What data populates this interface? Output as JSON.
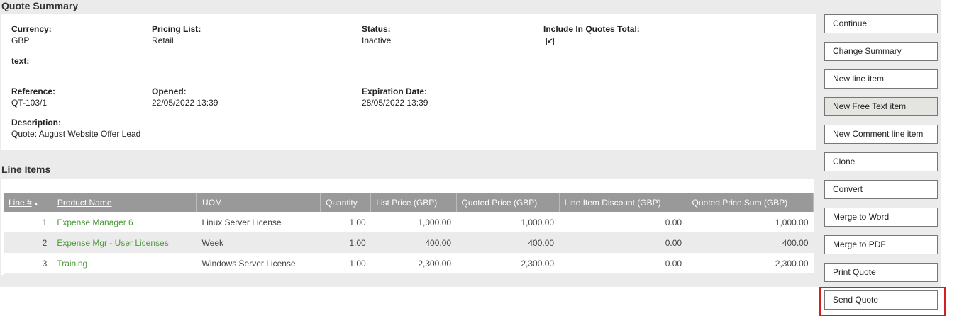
{
  "summary": {
    "title": "Quote Summary",
    "currency_label": "Currency:",
    "currency": "GBP",
    "pricing_label": "Pricing List:",
    "pricing": "Retail",
    "status_label": "Status:",
    "status": "Inactive",
    "include_label": "Include In Quotes Total:",
    "include_checked": true,
    "text_label": "text:",
    "reference_label": "Reference:",
    "reference": "QT-103/1",
    "opened_label": "Opened:",
    "opened": "22/05/2022 13:39",
    "expiration_label": "Expiration Date:",
    "expiration": "28/05/2022 13:39",
    "description_label": "Description:",
    "description": "Quote: August Website Offer Lead"
  },
  "line_items": {
    "title": "Line Items",
    "columns": [
      "Line #",
      "Product Name",
      "UOM",
      "Quantity",
      "List Price (GBP)",
      "Quoted Price (GBP)",
      "Line Item Discount (GBP)",
      "Quoted Price Sum (GBP)"
    ],
    "sort_icon": "sort-ascending-icon",
    "rows": [
      [
        "1",
        "Expense Manager 6",
        "Linux Server License",
        "1.00",
        "1,000.00",
        "1,000.00",
        "0.00",
        "1,000.00"
      ],
      [
        "2",
        "Expense Mgr - User Licenses",
        "Week",
        "1.00",
        "400.00",
        "400.00",
        "0.00",
        "400.00"
      ],
      [
        "3",
        "Training",
        "Windows Server License",
        "1.00",
        "2,300.00",
        "2,300.00",
        "0.00",
        "2,300.00"
      ]
    ]
  },
  "actions": [
    "Continue",
    "Change Summary",
    "New line item",
    "New Free Text item",
    "New Comment line item",
    "Clone",
    "Convert",
    "Merge to Word",
    "Merge to PDF",
    "Print Quote",
    "Send Quote"
  ],
  "colors": {
    "link": "#4a9a3a",
    "header": "#999999",
    "highlight": "#d02020"
  }
}
